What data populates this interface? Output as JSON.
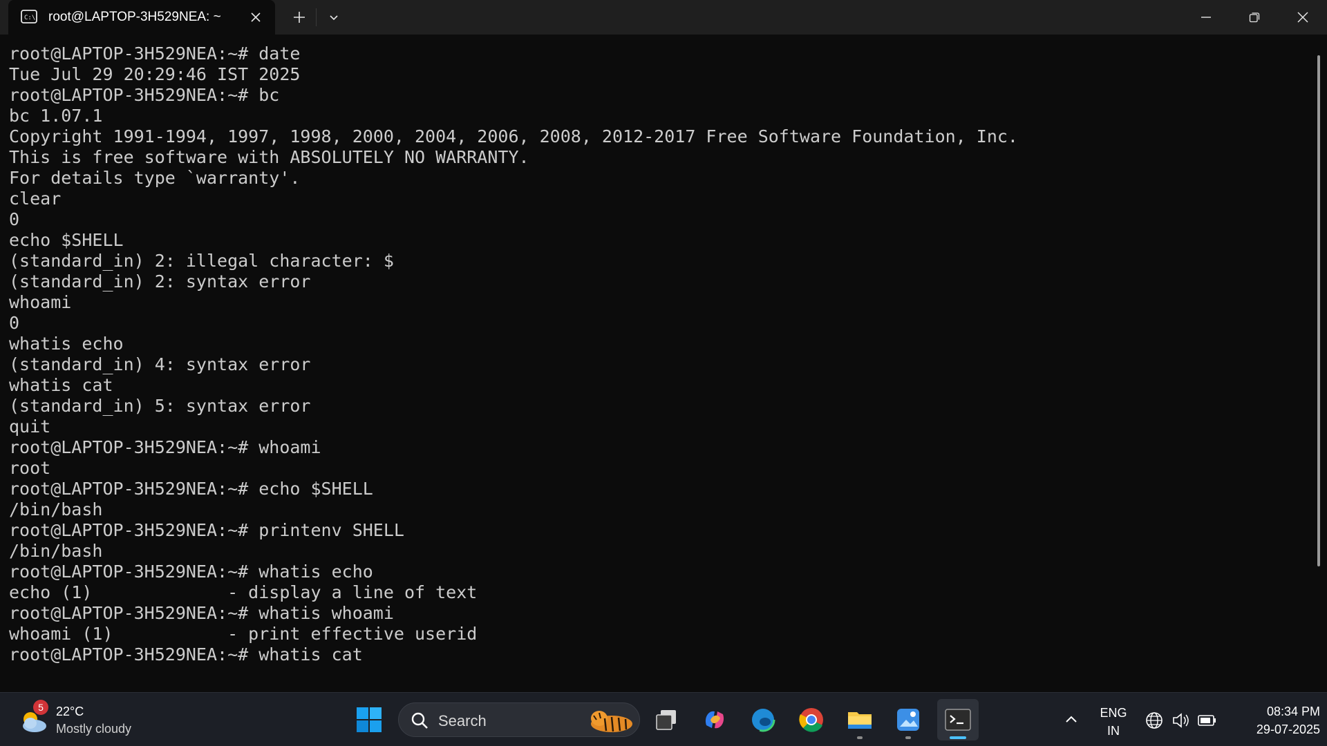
{
  "window": {
    "tab_title": "root@LAPTOP-3H529NEA: ~"
  },
  "terminal": {
    "lines": [
      "root@LAPTOP-3H529NEA:~# date",
      "Tue Jul 29 20:29:46 IST 2025",
      "root@LAPTOP-3H529NEA:~# bc",
      "bc 1.07.1",
      "Copyright 1991-1994, 1997, 1998, 2000, 2004, 2006, 2008, 2012-2017 Free Software Foundation, Inc.",
      "This is free software with ABSOLUTELY NO WARRANTY.",
      "For details type `warranty'.",
      "clear",
      "0",
      "echo $SHELL",
      "(standard_in) 2: illegal character: $",
      "(standard_in) 2: syntax error",
      "whoami",
      "0",
      "whatis echo",
      "(standard_in) 4: syntax error",
      "whatis cat",
      "(standard_in) 5: syntax error",
      "quit",
      "root@LAPTOP-3H529NEA:~# whoami",
      "root",
      "root@LAPTOP-3H529NEA:~# echo $SHELL",
      "/bin/bash",
      "root@LAPTOP-3H529NEA:~# printenv SHELL",
      "/bin/bash",
      "root@LAPTOP-3H529NEA:~# whatis echo",
      "echo (1)             - display a line of text",
      "root@LAPTOP-3H529NEA:~# whatis whoami",
      "whoami (1)           - print effective userid",
      "root@LAPTOP-3H529NEA:~# whatis cat"
    ]
  },
  "taskbar": {
    "weather": {
      "badge": "5",
      "temperature": "22°C",
      "condition": "Mostly cloudy"
    },
    "search_label": "Search",
    "language": [
      "ENG",
      "IN"
    ],
    "time": "08:34 PM",
    "date": "29-07-2025",
    "apps": [
      "start-icon",
      "task-view-icon",
      "copilot-icon",
      "edge-icon",
      "chrome-icon",
      "file-explorer-icon",
      "photos-icon",
      "terminal-icon"
    ]
  }
}
